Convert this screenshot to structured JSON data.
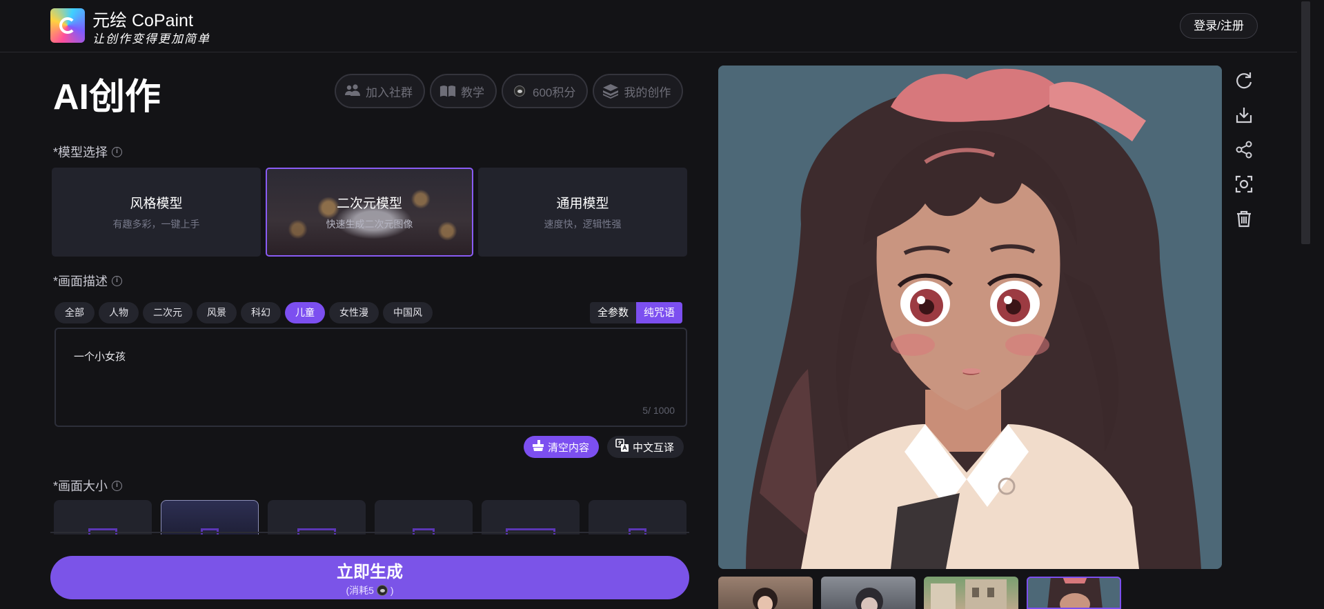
{
  "header": {
    "brand_name": "元绘 CoPaint",
    "slogan": "让创作变得更加简单",
    "login_label": "登录/注册"
  },
  "page": {
    "title": "AI创作",
    "actions": [
      {
        "label": "加入社群",
        "icon": "users-icon"
      },
      {
        "label": "教学",
        "icon": "book-icon"
      },
      {
        "label": "600积分",
        "icon": "coin-icon"
      },
      {
        "label": "我的创作",
        "icon": "layers-icon"
      }
    ]
  },
  "model": {
    "label": "*模型选择",
    "options": [
      {
        "title": "风格模型",
        "subtitle": "有趣多彩，一键上手"
      },
      {
        "title": "二次元模型",
        "subtitle": "快速生成二次元图像"
      },
      {
        "title": "通用模型",
        "subtitle": "速度快，逻辑性强"
      }
    ],
    "selected": "二次元模型"
  },
  "prompt": {
    "label": "*画面描述",
    "tags": [
      "全部",
      "人物",
      "二次元",
      "风景",
      "科幻",
      "儿童",
      "女性漫",
      "中国风"
    ],
    "selected_tag": "儿童",
    "modes": [
      "全参数",
      "纯咒语"
    ],
    "selected_mode": "纯咒语",
    "value": "一个小女孩",
    "counter": "5/ 1000",
    "clear_label": "清空内容",
    "translate_label": "中文互译"
  },
  "size": {
    "label": "*画面大小",
    "selected_index": 1
  },
  "generate": {
    "label": "立即生成",
    "cost_prefix": "(消耗5",
    "cost_suffix": ")"
  },
  "tools": [
    "refresh-icon",
    "download-icon",
    "share-icon",
    "screenshot-icon",
    "trash-icon"
  ],
  "thumbnails": {
    "count": 4,
    "selected_index": 3
  },
  "colors": {
    "accent": "#7c4ff0",
    "background": "#131316",
    "card": "#22232c"
  }
}
